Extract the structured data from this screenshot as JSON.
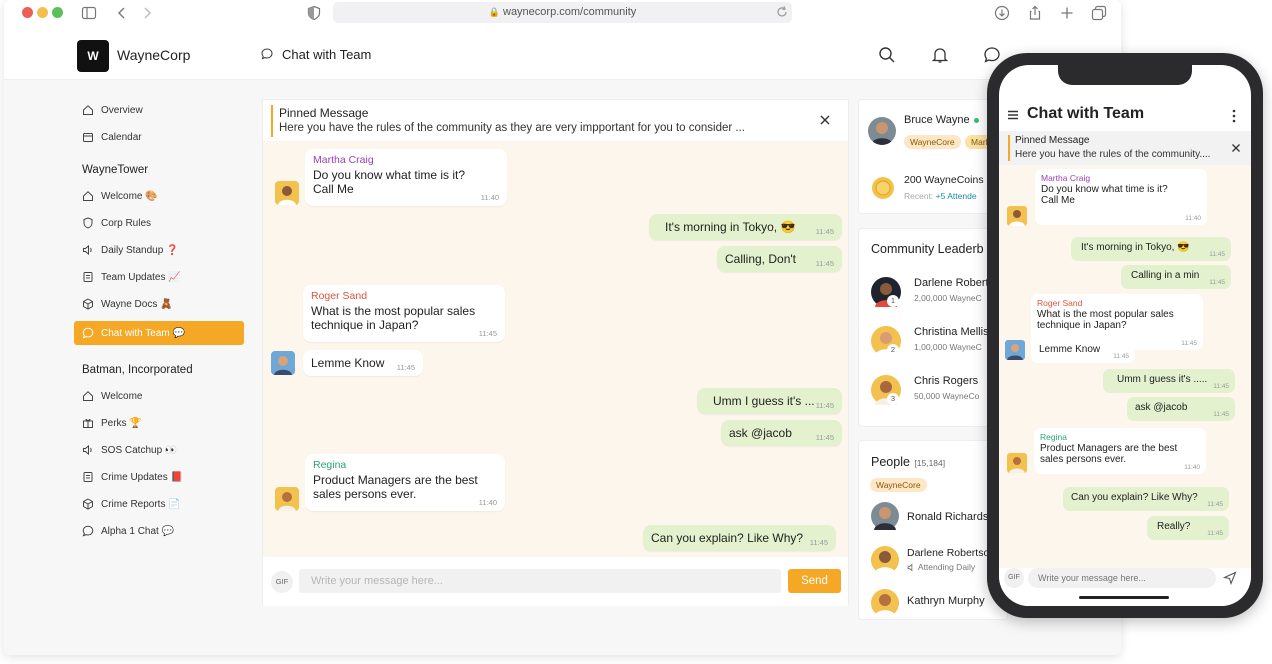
{
  "browser": {
    "url": "waynecorp.com/community"
  },
  "header": {
    "brand": "WayneCorp",
    "logo_text": "W",
    "chat_title": "Chat with Team"
  },
  "sidebar": {
    "top": [
      "Overview",
      "Calendar"
    ],
    "group1": {
      "title": "WayneTower",
      "items": [
        "Welcome 🎨",
        "Corp Rules",
        "Daily Standup ❓",
        "Team Updates 📈",
        "Wayne Docs 🧸",
        "Chat with Team 💬"
      ]
    },
    "group2": {
      "title": "Batman, Incorporated",
      "items": [
        "Welcome",
        "Perks 🏆",
        "SOS Catchup 👀",
        "Crime Updates 📕",
        "Crime Reports 📄",
        "Alpha 1 Chat 💬"
      ]
    }
  },
  "pinned": {
    "title": "Pinned Message",
    "text": "Here you have the rules of the community as they are very impportant for you to consider ..."
  },
  "messages": [
    {
      "sender": "Martha Craig",
      "text1": "Do you know what time is it?",
      "text2": "Call Me",
      "time": "11:40",
      "color": "#9b3fb6"
    },
    {
      "text": "It's morning in Tokyo,   😎",
      "time": "11:45"
    },
    {
      "text": "Calling, Don't",
      "time": "11:45"
    },
    {
      "sender": "Roger Sand",
      "text1": "What is the most popular sales",
      "text2": "technique in Japan?",
      "time": "11:45",
      "color": "#e0533a"
    },
    {
      "text": "Lemme Know",
      "time": "11:45"
    },
    {
      "text": "Umm I guess it's ...",
      "time": "11:45"
    },
    {
      "text": "ask @jacob",
      "time": "11:45"
    },
    {
      "sender": "Regina",
      "text1": "Product Managers are the best",
      "text2": "sales persons ever.",
      "time": "11:40",
      "color": "#2aa37a"
    },
    {
      "text": "Can you explain? Like Why?",
      "time": "11:45"
    }
  ],
  "composer": {
    "gif": "GIF",
    "placeholder": "Write your message here...",
    "send": "Send"
  },
  "profile": {
    "name": "Bruce Wayne",
    "tag1": "WayneCore",
    "tag2": "Marl",
    "coins": "200 WayneCoins",
    "recent_label": "Recent:",
    "recent": "+5 Attende"
  },
  "leaderboard": {
    "title": "Community Leaderb",
    "items": [
      {
        "name": "Darlene Robert",
        "sub": "2,00,000 WayneC",
        "rank": "1"
      },
      {
        "name": "Christina Mellis",
        "sub": "1,00,000 WayneC",
        "rank": "2"
      },
      {
        "name": "Chris Rogers",
        "sub": "50,000 WayneCo",
        "rank": "3"
      }
    ]
  },
  "people": {
    "title": "People",
    "count": "[15,184]",
    "tag": "WayneCore",
    "items": [
      {
        "name": "Ronald Richards",
        "sub": ""
      },
      {
        "name": "Darlene Robertso",
        "sub": "Attending Daily"
      },
      {
        "name": "Kathryn Murphy",
        "sub": ""
      }
    ]
  },
  "phone": {
    "title": "Chat with Team",
    "pinned_title": "Pinned Message",
    "pinned_text": "Here you have the rules of the community....",
    "messages": [
      {
        "sender": "Martha Craig",
        "text1": "Do you know what time is it?",
        "text2": "Call Me",
        "time": "11:40"
      },
      {
        "text": "It's morning in Tokyo,   😎",
        "time": "11:45"
      },
      {
        "text": "Calling in a min",
        "time": "11:45"
      },
      {
        "sender": "Roger Sand",
        "text1": "What is the most popular sales",
        "text2": "technique in Japan?",
        "time": "11:45"
      },
      {
        "text": "Lemme Know",
        "time": "11:45"
      },
      {
        "text": "Umm I guess it's .....",
        "time": "11:45"
      },
      {
        "text": "ask @jacob",
        "time": "11:45"
      },
      {
        "sender": "Regina",
        "text1": "Product Managers are the best",
        "text2": "sales persons ever.",
        "time": "11:40"
      },
      {
        "text": "Can you explain? Like Why?",
        "time": "11:45"
      },
      {
        "text": "Really?",
        "time": "11:45"
      }
    ],
    "gif": "GIF",
    "placeholder": "Write your message here..."
  }
}
